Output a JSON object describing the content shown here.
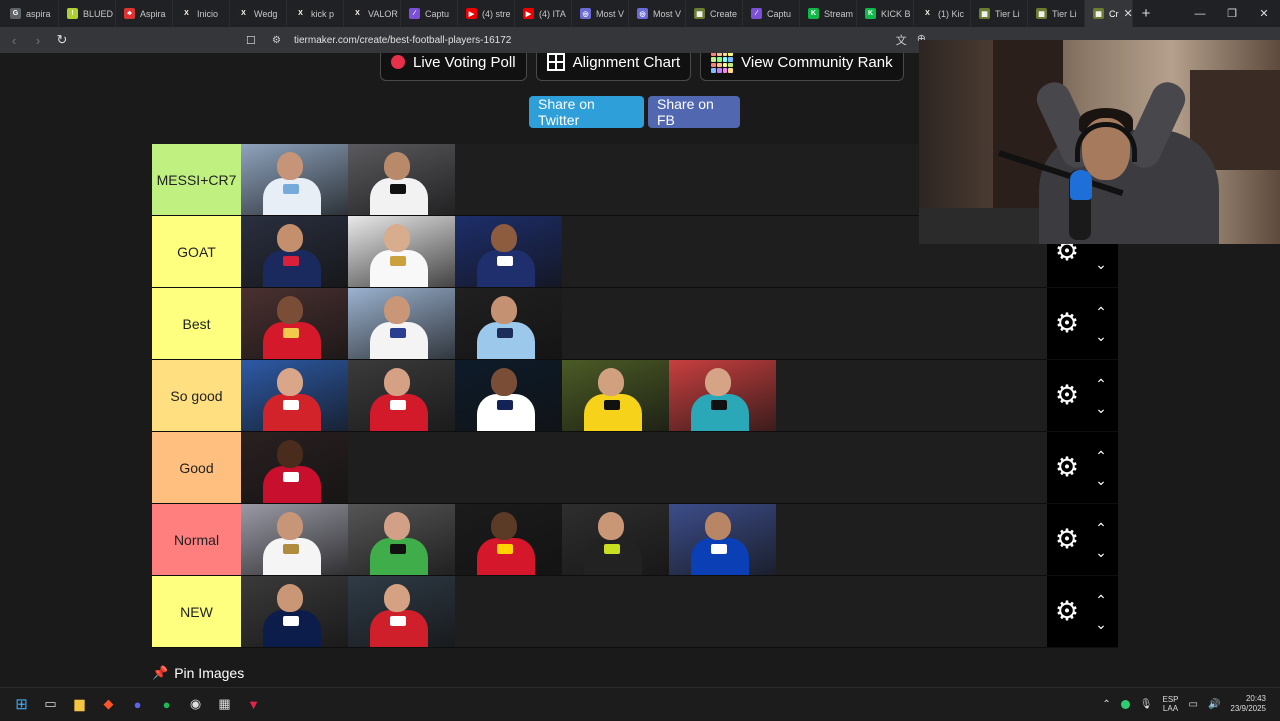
{
  "browser": {
    "tabs": [
      {
        "title": "aspira",
        "color": "#5f6368",
        "glyph": "G"
      },
      {
        "title": "BLUED",
        "color": "#b0d030",
        "glyph": "!"
      },
      {
        "title": "Aspira",
        "color": "#d33",
        "glyph": "♣"
      },
      {
        "title": "Inicio",
        "color": "#222",
        "glyph": "X"
      },
      {
        "title": "Wedg",
        "color": "#222",
        "glyph": "X"
      },
      {
        "title": "kick p",
        "color": "#222",
        "glyph": "X"
      },
      {
        "title": "VALOR",
        "color": "#222",
        "glyph": "X"
      },
      {
        "title": "Captu",
        "color": "#7b4fd6",
        "glyph": "∕"
      },
      {
        "title": "(4) stre",
        "color": "#e00",
        "glyph": "▶"
      },
      {
        "title": "(4) ITA",
        "color": "#e00",
        "glyph": "▶"
      },
      {
        "title": "Most V",
        "color": "#6b6bd6",
        "glyph": "◎"
      },
      {
        "title": "Most V",
        "color": "#6b6bd6",
        "glyph": "◎"
      },
      {
        "title": "Create",
        "color": "#6b7c33",
        "glyph": "▦"
      },
      {
        "title": "Captu",
        "color": "#7b4fd6",
        "glyph": "∕"
      },
      {
        "title": "Stream",
        "color": "#10b84a",
        "glyph": "K"
      },
      {
        "title": "KICK B",
        "color": "#10b84a",
        "glyph": "K"
      },
      {
        "title": "(1) Kic",
        "color": "#222",
        "glyph": "X"
      },
      {
        "title": "Tier Li",
        "color": "#6b7c33",
        "glyph": "▦"
      },
      {
        "title": "Tier Li",
        "color": "#6b7c33",
        "glyph": "▦"
      }
    ],
    "active_tab": {
      "title": "Cr",
      "color": "#6b7c33",
      "glyph": "▦"
    },
    "close_glyph": "✕",
    "new_tab_glyph": "+",
    "url": "tiermaker.com/create/best-football-players-16172"
  },
  "toolbar": {
    "live_voting": "Live Voting Poll",
    "alignment": "Alignment Chart",
    "community": "View Community Rank"
  },
  "share": {
    "twitter": "Share on Twitter",
    "fb": "Share on FB"
  },
  "tiers": [
    {
      "label": "MESSI+CR7",
      "color": "#bff080",
      "players": [
        {
          "bg": "#8ea3bd",
          "skin": "#c69478",
          "kit": "#e8eef6",
          "accent": "#75aadb"
        },
        {
          "bg": "#5a5a5e",
          "skin": "#b98a6a",
          "kit": "#f2f2f2",
          "accent": "#111111"
        }
      ]
    },
    {
      "label": "GOAT",
      "color": "#ffff7f",
      "players": [
        {
          "bg": "#2a2f3f",
          "skin": "#c38f6c",
          "kit": "#1b2a5e",
          "accent": "#d9203a"
        },
        {
          "bg": "#e9e9e9",
          "skin": "#d8ad8e",
          "kit": "#f8f8f8",
          "accent": "#caa13c"
        },
        {
          "bg": "#1d2e6b",
          "skin": "#8d5c3f",
          "kit": "#1f2f6e",
          "accent": "#ffffff"
        }
      ]
    },
    {
      "label": "Best",
      "color": "#ffff7f",
      "players": [
        {
          "bg": "#4a3030",
          "skin": "#7a4e36",
          "kit": "#d4192b",
          "accent": "#f2c94c"
        },
        {
          "bg": "#9bb2cf",
          "skin": "#c99677",
          "kit": "#f4f4f4",
          "accent": "#2a3f8f"
        },
        {
          "bg": "#202020",
          "skin": "#c49272",
          "kit": "#9cc8ec",
          "accent": "#1c2c5b"
        }
      ]
    },
    {
      "label": "So good",
      "color": "#ffdf7f",
      "players": [
        {
          "bg": "#2d5aa6",
          "skin": "#d9a68a",
          "kit": "#d2232a",
          "accent": "#ffffff"
        },
        {
          "bg": "#3b3b3b",
          "skin": "#d4a184",
          "kit": "#d21a2b",
          "accent": "#ffffff"
        },
        {
          "bg": "#0d1b2a",
          "skin": "#7a4e36",
          "kit": "#ffffff",
          "accent": "#132257"
        },
        {
          "bg": "#4b5b25",
          "skin": "#d1a07e",
          "kit": "#f7d21b",
          "accent": "#111111"
        },
        {
          "bg": "#c83f3f",
          "skin": "#d5a486",
          "kit": "#2aa8b8",
          "accent": "#111111"
        }
      ]
    },
    {
      "label": "Good",
      "color": "#ffbf7f",
      "players": [
        {
          "bg": "#2a2020",
          "skin": "#4a2c1d",
          "kit": "#c8102e",
          "accent": "#ffffff"
        }
      ]
    },
    {
      "label": "Normal",
      "color": "#ff7f7f",
      "players": [
        {
          "bg": "#9a9aa6",
          "skin": "#c79678",
          "kit": "#f5f5f5",
          "accent": "#b08d3e"
        },
        {
          "bg": "#555555",
          "skin": "#d2a086",
          "kit": "#3fae4a",
          "accent": "#111111"
        },
        {
          "bg": "#1b1b1b",
          "skin": "#5b3a26",
          "kit": "#d4172a",
          "accent": "#ffd200"
        },
        {
          "bg": "#2e2e2e",
          "skin": "#c99676",
          "kit": "#222222",
          "accent": "#c8e020"
        },
        {
          "bg": "#3c4d8a",
          "skin": "#b88565",
          "kit": "#0a3fb5",
          "accent": "#ffffff"
        }
      ]
    },
    {
      "label": "NEW",
      "color": "#ffff7f",
      "players": [
        {
          "bg": "#3a3a3a",
          "skin": "#c99676",
          "kit": "#0d1d4b",
          "accent": "#ffffff"
        },
        {
          "bg": "#2f3b46",
          "skin": "#d4a282",
          "kit": "#cf1f2a",
          "accent": "#ffffff"
        }
      ]
    }
  ],
  "pin_images": "Pin Images",
  "tray": {
    "lang_top": "ESP",
    "lang_bottom": "LAA",
    "time": "20:43",
    "date": "23/9/2025"
  }
}
